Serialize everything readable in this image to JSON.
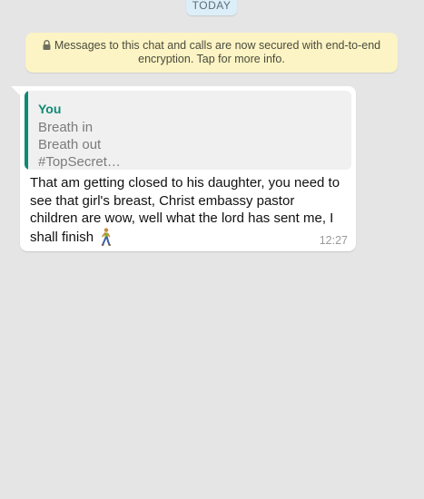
{
  "date_chip": {
    "label": "TODAY"
  },
  "encryption_notice": {
    "line1": "Messages to this chat and calls are now secured with end-to-end",
    "line2": "encryption. Tap for more info."
  },
  "message": {
    "quote": {
      "author": "You",
      "lines": [
        "Breath in",
        "Breath out",
        "#TopSecret…"
      ]
    },
    "text": "That am getting closed to his daughter, you need to see that girl's breast, Christ embassy pastor children are wow, well what the lord has sent me, I shall finish",
    "emoji_icon": "person-walking-icon",
    "time": "12:27"
  },
  "colors": {
    "chat_background": "#e5e5e5",
    "notice_background": "#fcf4c4",
    "date_chip_background": "#dceef8",
    "quote_accent": "#0f8a74",
    "bubble_background": "#ffffff"
  }
}
